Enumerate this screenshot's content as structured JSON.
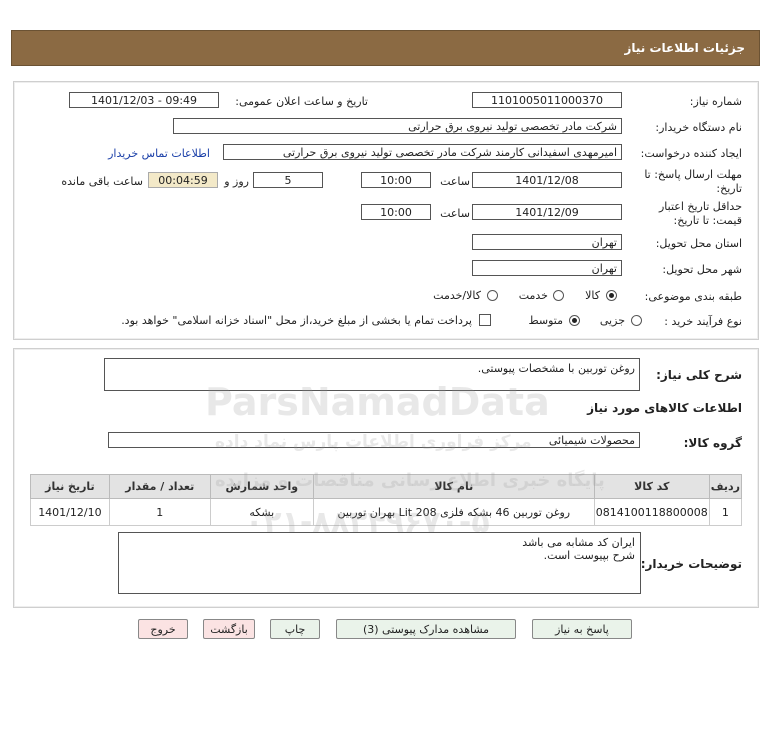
{
  "header": {
    "title": "جزئیات اطلاعات نیاز"
  },
  "fields": {
    "need_number_label": "شماره نیاز:",
    "need_number": "1101005011000370",
    "announce_label": "تاریخ و ساعت اعلان عمومی:",
    "announce_value": "1401/12/03 - 09:49",
    "buyer_org_label": "نام دستگاه خریدار:",
    "buyer_org": "شرکت مادر تخصصی تولید نیروی برق حرارتی",
    "creator_label": "ایجاد کننده درخواست:",
    "creator": "امیرمهدی اسفیدانی کارمند شرکت مادر تخصصی تولید نیروی برق حرارتی",
    "contact_link": "اطلاعات تماس خریدار",
    "reply_deadline_label": "مهلت ارسال پاسخ: تا تاریخ:",
    "reply_date": "1401/12/08",
    "time_label": "ساعت",
    "reply_time": "10:00",
    "days_value": "5",
    "days_label": "روز و",
    "remaining_value": "00:04:59",
    "remaining_label": "ساعت باقی مانده",
    "validity_label": "حداقل تاریخ اعتبار قیمت: تا تاریخ:",
    "validity_date": "1401/12/09",
    "validity_time": "10:00",
    "province_label": "استان محل تحویل:",
    "province": "تهران",
    "city_label": "شهر محل تحویل:",
    "city": "تهران",
    "category_label": "طبقه بندی موضوعی:",
    "category_options": [
      "کالا",
      "خدمت",
      "کالا/خدمت"
    ],
    "process_label": "نوع فرآیند خرید :",
    "process_options": [
      "جزیی",
      "متوسط"
    ],
    "payment_note": "پرداخت تمام یا بخشی از مبلغ خرید،از محل \"اسناد خزانه اسلامی\" خواهد بود."
  },
  "summary": {
    "label": "شرح کلی نیاز:",
    "value": "روغن توربین با مشخصات پیوستی."
  },
  "goods": {
    "section_title": "اطلاعات کالاهای مورد نیاز",
    "group_label": "گروه کالا:",
    "group_value": "محصولات شیمیائی",
    "columns": [
      "ردیف",
      "کد کالا",
      "نام کالا",
      "واحد شمارش",
      "تعداد / مقدار",
      "تاریخ نیاز"
    ],
    "rows": [
      [
        "1",
        "0814100118800008",
        "روغن توربین 46 بشکه فلزی 208 Lit بهران توربین",
        "بشکه",
        "1",
        "1401/12/10"
      ]
    ]
  },
  "buyer_notes": {
    "label": "توضیحات خریدار:",
    "line1": "ایران کد مشابه می باشد",
    "line2": "شرح بپیوست است."
  },
  "buttons": {
    "reply": "پاسخ به نیاز",
    "docs": "مشاهده مدارک پیوستی (3)",
    "print": "چاپ",
    "back": "بازگشت",
    "exit": "خروج"
  },
  "watermark": {
    "line1": "ParsNamadData",
    "line2": "مرکز فراوری اطلاعات پارس نماد داده",
    "line3": "پایگاه خبری اطلاع رسانی مناقصات و مزایده",
    "line4": "۰۲۱-۸۸۳۴۹۶۷۰-۵"
  },
  "colors": {
    "titlebar": "#8b6a43",
    "button": "#eaf3ea",
    "button_alt": "#fbe3e3",
    "link": "#1a3fa8"
  }
}
